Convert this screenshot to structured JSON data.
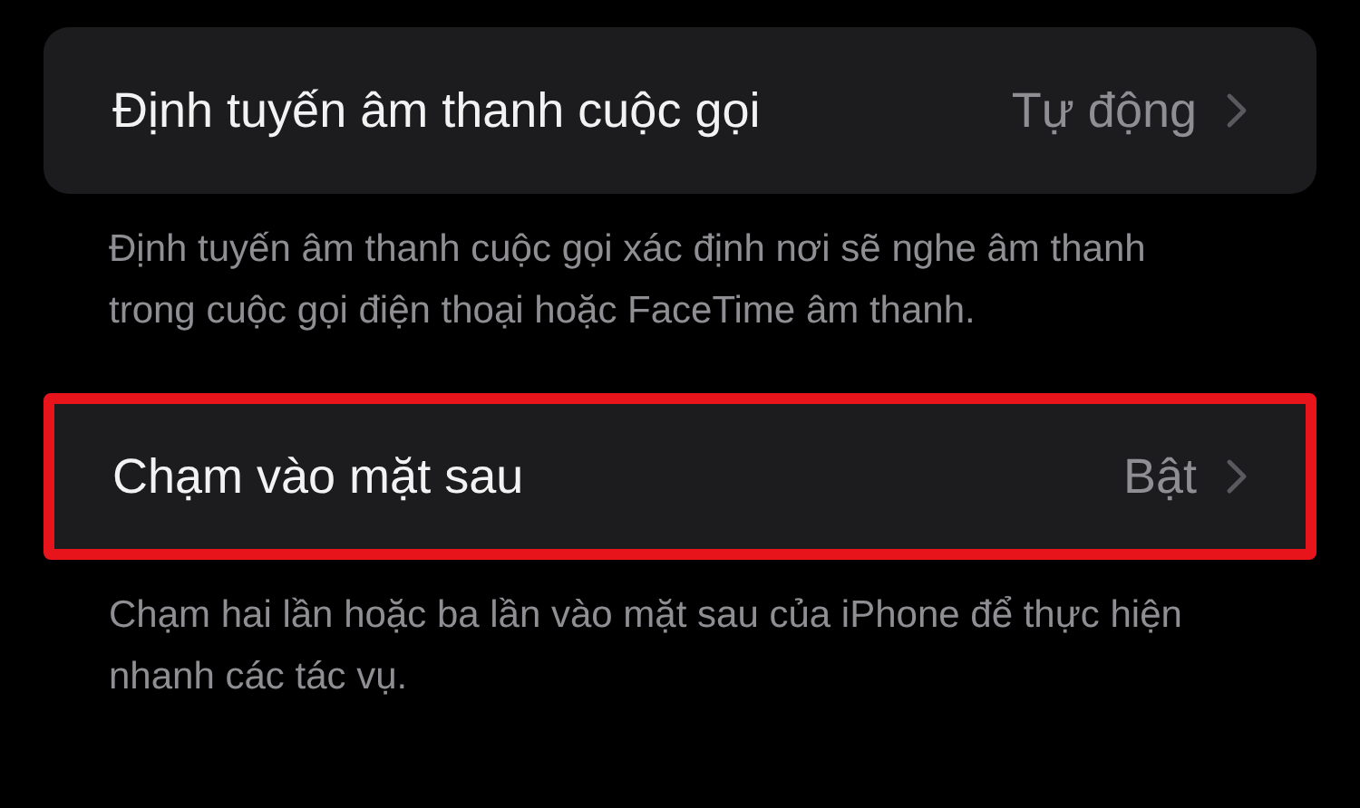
{
  "sections": [
    {
      "row": {
        "label": "Định tuyến âm thanh cuộc gọi",
        "value": "Tự động",
        "highlighted": false
      },
      "footer": "Định tuyến âm thanh cuộc gọi xác định nơi sẽ nghe âm thanh trong cuộc gọi điện thoại hoặc FaceTime âm thanh."
    },
    {
      "row": {
        "label": "Chạm vào mặt sau",
        "value": "Bật",
        "highlighted": true
      },
      "footer": "Chạm hai lần hoặc ba lần vào mặt sau của iPhone để thực hiện nhanh các tác vụ."
    }
  ]
}
